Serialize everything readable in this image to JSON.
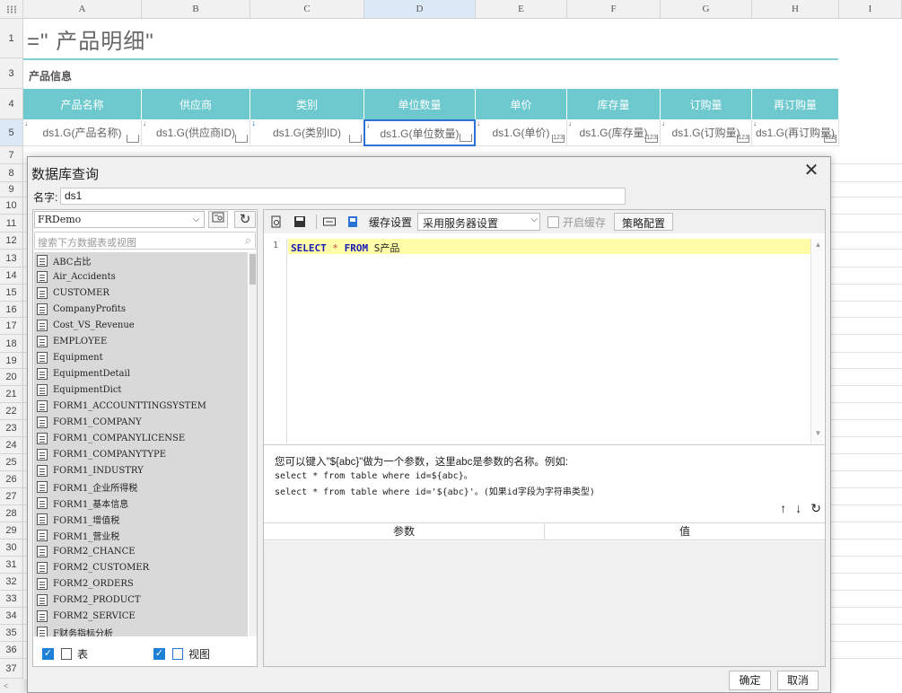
{
  "sheet": {
    "columns": [
      "A",
      "B",
      "C",
      "D",
      "E",
      "F",
      "G",
      "H",
      "I"
    ],
    "rows": [
      "1",
      "3",
      "4",
      "5",
      "7",
      "8",
      "9",
      "10",
      "11",
      "12",
      "13",
      "14",
      "15",
      "16",
      "17",
      "18",
      "19",
      "20",
      "21",
      "22",
      "23",
      "24",
      "25",
      "26",
      "27",
      "28",
      "29",
      "30",
      "31",
      "32",
      "33",
      "34",
      "35",
      "36",
      "37"
    ],
    "title": "=\"  产品明细\"",
    "section": "产品信息",
    "headers": [
      "产品名称",
      "供应商",
      "类别",
      "单位数量",
      "单价",
      "库存量",
      "订购量",
      "再订购量"
    ],
    "cells": [
      "ds1.G(产品名称)",
      "ds1.G(供应商ID)",
      "ds1.G(类别ID)",
      "ds1.G(单位数量)",
      "ds1.G(单价)",
      "ds1.G(库存量)",
      "ds1.G(订购量)",
      "ds1.G(再订购量)"
    ],
    "flag_numeric": "123"
  },
  "dialog": {
    "title": "数据库查询",
    "close_icon": "✕",
    "name_label": "名字:",
    "name_value": "ds1",
    "datasource": "FRDemo",
    "search_placeholder": "搜索下方数据表或视图",
    "tables": [
      "ABC占比",
      "Air_Accidents",
      "CUSTOMER",
      "CompanyProfits",
      "Cost_VS_Revenue",
      "EMPLOYEE",
      "Equipment",
      "EquipmentDetail",
      "EquipmentDict",
      "FORM1_ACCOUNTTINGSYSTEM",
      "FORM1_COMPANY",
      "FORM1_COMPANYLICENSE",
      "FORM1_COMPANYTYPE",
      "FORM1_INDUSTRY",
      "FORM1_企业所得税",
      "FORM1_基本信息",
      "FORM1_增值税",
      "FORM1_营业税",
      "FORM2_CHANCE",
      "FORM2_CUSTOMER",
      "FORM2_ORDERS",
      "FORM2_PRODUCT",
      "FORM2_SERVICE",
      "F财务指标分析"
    ],
    "check_table": "表",
    "check_view": "视图",
    "toolbar": {
      "cache_label": "缓存设置",
      "cache_value": "采用服务器设置",
      "enable_cache": "开启缓存",
      "policy_button": "策略配置"
    },
    "sql": {
      "line": "1",
      "kw_select": "SELECT",
      "star": "*",
      "kw_from": "FROM",
      "table": "S产品"
    },
    "hint": {
      "line1": "您可以键入\"${abc}\"做为一个参数，这里abc是参数的名称。例如:",
      "line2": "select * from table where id=${abc}。",
      "line3": "select * from table where id='${abc}'。(如果id字段为字符串类型)"
    },
    "param_headers": {
      "param": "参数",
      "value": "值"
    },
    "ok_button": "确定",
    "cancel_button": "取消"
  }
}
